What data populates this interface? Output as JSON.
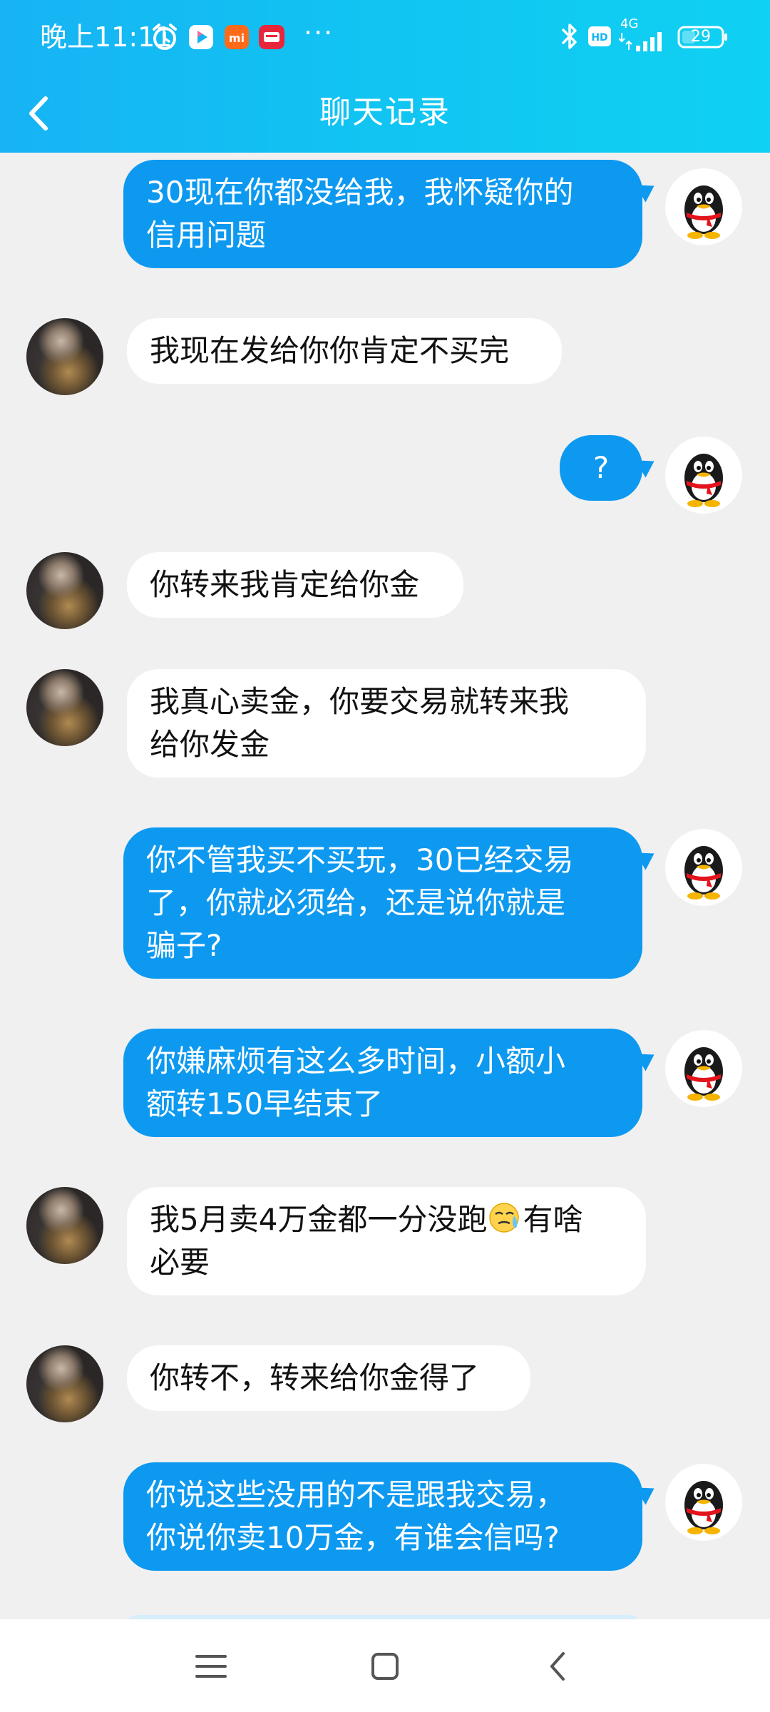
{
  "status_bar": {
    "time": "晚上11:11",
    "network": "4G",
    "battery": "29",
    "more": "···",
    "icons": [
      "alarm-icon",
      "video-app-icon",
      "mi-app-icon",
      "shopping-app-icon",
      "bluetooth-icon",
      "hd-icon",
      "signal-icon",
      "battery-icon"
    ]
  },
  "header": {
    "title": "聊天记录",
    "back_icon": "chevron-left-icon"
  },
  "messages": [
    {
      "side": "right",
      "avatar": "penguin-avatar",
      "text": "30现在你都没给我，我怀疑你的\n信用问题"
    },
    {
      "side": "left",
      "avatar": "user-photo-avatar",
      "text": "我现在发给你你肯定不买完"
    },
    {
      "side": "right",
      "avatar": "penguin-avatar",
      "text": "?"
    },
    {
      "side": "left",
      "avatar": "user-photo-avatar",
      "text": "你转来我肯定给你金"
    },
    {
      "side": "left",
      "avatar": "user-photo-avatar",
      "text": "我真心卖金，你要交易就转来我\n给你发金"
    },
    {
      "side": "right",
      "avatar": "penguin-avatar",
      "text": "你不管我买不买玩，30已经交易\n了，你就必须给，还是说你就是\n骗子?"
    },
    {
      "side": "right",
      "avatar": "penguin-avatar",
      "text": "你嫌麻烦有这么多时间，小额小\n额转150早结束了"
    },
    {
      "side": "left",
      "avatar": "user-photo-avatar",
      "text_before_emoji": "我5月卖4万金都一分没跑",
      "emoji": "sweat-emoji",
      "text_after_emoji": "有啥\n必要"
    },
    {
      "side": "left",
      "avatar": "user-photo-avatar",
      "text": "你转不，转来给你金得了"
    },
    {
      "side": "right",
      "avatar": "penguin-avatar",
      "text": "你说这些没用的不是跟我交易，\n你说你卖10万金，有谁会信吗?"
    }
  ],
  "colors": {
    "header_start": "#17b3f4",
    "header_end": "#0fd1f2",
    "bubble_self": "#0d99f0",
    "bubble_other": "#ffffff",
    "background": "#f0f0f0"
  },
  "nav_bar": {
    "icons": [
      "menu-icon",
      "home-square-icon",
      "back-triangle-icon"
    ]
  }
}
